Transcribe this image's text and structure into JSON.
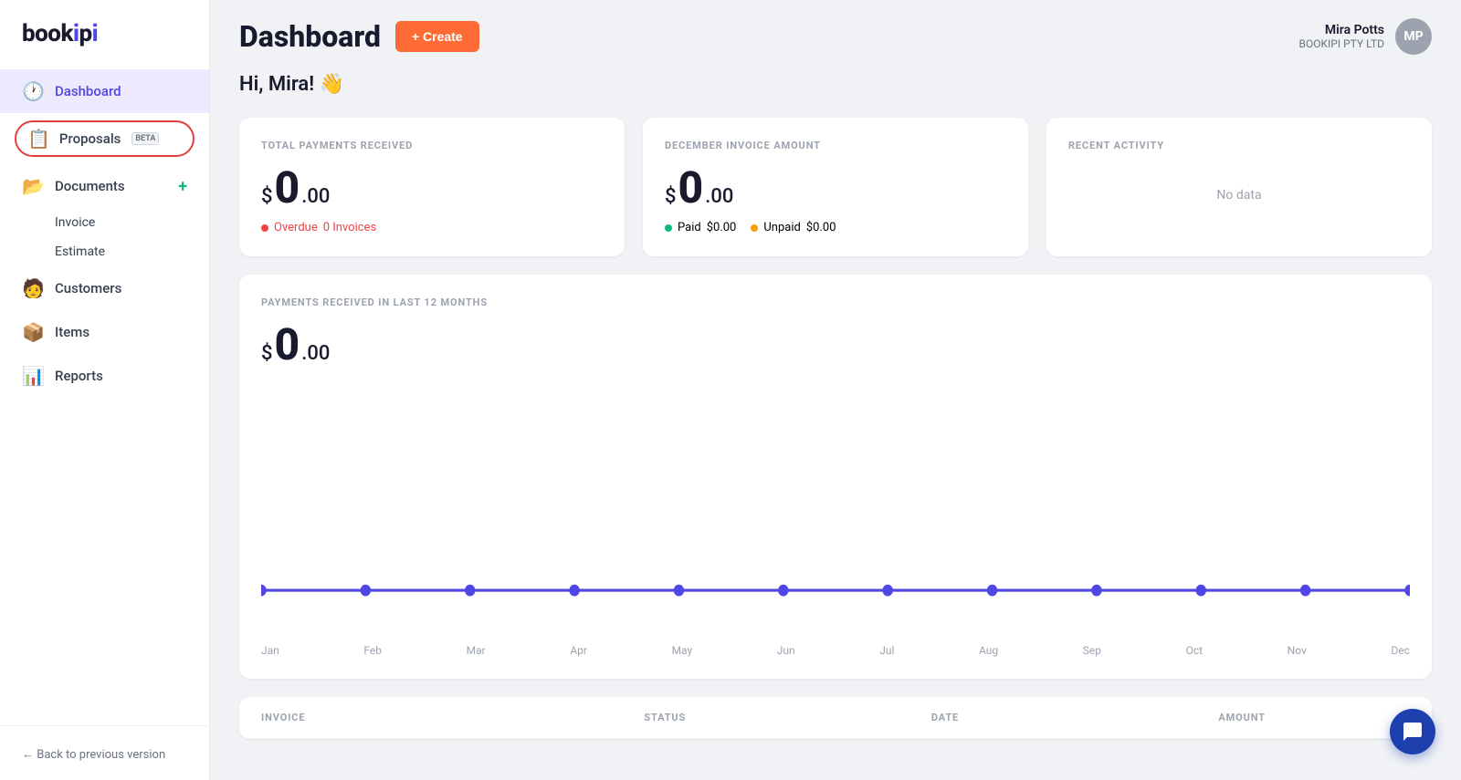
{
  "app": {
    "logo": "bookipi",
    "logo_dot": "i"
  },
  "sidebar": {
    "items": [
      {
        "id": "dashboard",
        "label": "Dashboard",
        "icon": "🕐",
        "active": true
      },
      {
        "id": "proposals",
        "label": "Proposals",
        "icon": "📋",
        "beta": "BETA",
        "circled": true
      },
      {
        "id": "documents",
        "label": "Documents",
        "icon": "📂",
        "hasAdd": true
      },
      {
        "id": "invoice",
        "label": "Invoice",
        "sub": true
      },
      {
        "id": "estimate",
        "label": "Estimate",
        "sub": true
      },
      {
        "id": "customers",
        "label": "Customers",
        "icon": "🧑"
      },
      {
        "id": "items",
        "label": "Items",
        "icon": "📦"
      },
      {
        "id": "reports",
        "label": "Reports",
        "icon": "📊"
      }
    ],
    "back_link": "← Back to previous version"
  },
  "header": {
    "title": "Dashboard",
    "create_btn": "+ Create",
    "user": {
      "name": "Mira Potts",
      "company": "BOOKIPI PTY LTD",
      "initials": "MP"
    }
  },
  "greeting": "Hi, Mira! 👋",
  "cards": {
    "total_payments": {
      "title": "TOTAL PAYMENTS RECEIVED",
      "currency": "$",
      "amount_whole": "0",
      "amount_decimal": ".00",
      "overdue_dot_color": "#ef4444",
      "overdue_label": "Overdue",
      "overdue_count": "0 Invoices"
    },
    "december_invoice": {
      "title": "DECEMBER INVOICE AMOUNT",
      "currency": "$",
      "amount_whole": "0",
      "amount_decimal": ".00",
      "paid_dot_color": "#10b981",
      "paid_label": "Paid",
      "paid_amount": "$0.00",
      "unpaid_dot_color": "#f59e0b",
      "unpaid_label": "Unpaid",
      "unpaid_amount": "$0.00"
    },
    "recent_activity": {
      "title": "RECENT ACTIVITY",
      "no_data": "No data"
    }
  },
  "chart": {
    "title": "PAYMENTS RECEIVED IN LAST 12 MONTHS",
    "currency": "$",
    "amount_whole": "0",
    "amount_decimal": ".00",
    "labels": [
      "Jan",
      "Feb",
      "Mar",
      "Apr",
      "May",
      "Jun",
      "Jul",
      "Aug",
      "Sep",
      "Oct",
      "Nov",
      "Dec"
    ],
    "line_color": "#4f46e5",
    "data_points": [
      0,
      0,
      0,
      0,
      0,
      0,
      0,
      0,
      0,
      0,
      0,
      0
    ]
  },
  "table": {
    "columns": [
      "INVOICE",
      "STATUS",
      "DATE",
      "AMOUNT"
    ]
  },
  "chat_icon": "💬"
}
